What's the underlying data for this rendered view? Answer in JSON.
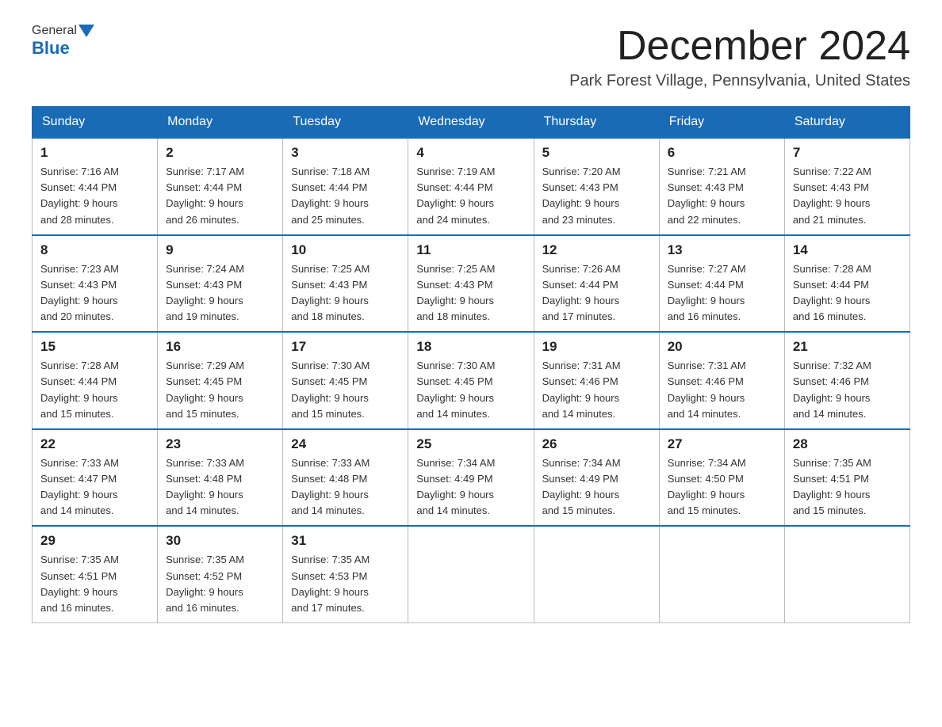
{
  "header": {
    "logo": {
      "general": "General",
      "blue": "Blue"
    },
    "title": "December 2024",
    "location": "Park Forest Village, Pennsylvania, United States"
  },
  "days_of_week": [
    "Sunday",
    "Monday",
    "Tuesday",
    "Wednesday",
    "Thursday",
    "Friday",
    "Saturday"
  ],
  "weeks": [
    [
      {
        "day": "1",
        "sunrise": "7:16 AM",
        "sunset": "4:44 PM",
        "daylight": "9 hours and 28 minutes."
      },
      {
        "day": "2",
        "sunrise": "7:17 AM",
        "sunset": "4:44 PM",
        "daylight": "9 hours and 26 minutes."
      },
      {
        "day": "3",
        "sunrise": "7:18 AM",
        "sunset": "4:44 PM",
        "daylight": "9 hours and 25 minutes."
      },
      {
        "day": "4",
        "sunrise": "7:19 AM",
        "sunset": "4:44 PM",
        "daylight": "9 hours and 24 minutes."
      },
      {
        "day": "5",
        "sunrise": "7:20 AM",
        "sunset": "4:43 PM",
        "daylight": "9 hours and 23 minutes."
      },
      {
        "day": "6",
        "sunrise": "7:21 AM",
        "sunset": "4:43 PM",
        "daylight": "9 hours and 22 minutes."
      },
      {
        "day": "7",
        "sunrise": "7:22 AM",
        "sunset": "4:43 PM",
        "daylight": "9 hours and 21 minutes."
      }
    ],
    [
      {
        "day": "8",
        "sunrise": "7:23 AM",
        "sunset": "4:43 PM",
        "daylight": "9 hours and 20 minutes."
      },
      {
        "day": "9",
        "sunrise": "7:24 AM",
        "sunset": "4:43 PM",
        "daylight": "9 hours and 19 minutes."
      },
      {
        "day": "10",
        "sunrise": "7:25 AM",
        "sunset": "4:43 PM",
        "daylight": "9 hours and 18 minutes."
      },
      {
        "day": "11",
        "sunrise": "7:25 AM",
        "sunset": "4:43 PM",
        "daylight": "9 hours and 18 minutes."
      },
      {
        "day": "12",
        "sunrise": "7:26 AM",
        "sunset": "4:44 PM",
        "daylight": "9 hours and 17 minutes."
      },
      {
        "day": "13",
        "sunrise": "7:27 AM",
        "sunset": "4:44 PM",
        "daylight": "9 hours and 16 minutes."
      },
      {
        "day": "14",
        "sunrise": "7:28 AM",
        "sunset": "4:44 PM",
        "daylight": "9 hours and 16 minutes."
      }
    ],
    [
      {
        "day": "15",
        "sunrise": "7:28 AM",
        "sunset": "4:44 PM",
        "daylight": "9 hours and 15 minutes."
      },
      {
        "day": "16",
        "sunrise": "7:29 AM",
        "sunset": "4:45 PM",
        "daylight": "9 hours and 15 minutes."
      },
      {
        "day": "17",
        "sunrise": "7:30 AM",
        "sunset": "4:45 PM",
        "daylight": "9 hours and 15 minutes."
      },
      {
        "day": "18",
        "sunrise": "7:30 AM",
        "sunset": "4:45 PM",
        "daylight": "9 hours and 14 minutes."
      },
      {
        "day": "19",
        "sunrise": "7:31 AM",
        "sunset": "4:46 PM",
        "daylight": "9 hours and 14 minutes."
      },
      {
        "day": "20",
        "sunrise": "7:31 AM",
        "sunset": "4:46 PM",
        "daylight": "9 hours and 14 minutes."
      },
      {
        "day": "21",
        "sunrise": "7:32 AM",
        "sunset": "4:46 PM",
        "daylight": "9 hours and 14 minutes."
      }
    ],
    [
      {
        "day": "22",
        "sunrise": "7:33 AM",
        "sunset": "4:47 PM",
        "daylight": "9 hours and 14 minutes."
      },
      {
        "day": "23",
        "sunrise": "7:33 AM",
        "sunset": "4:48 PM",
        "daylight": "9 hours and 14 minutes."
      },
      {
        "day": "24",
        "sunrise": "7:33 AM",
        "sunset": "4:48 PM",
        "daylight": "9 hours and 14 minutes."
      },
      {
        "day": "25",
        "sunrise": "7:34 AM",
        "sunset": "4:49 PM",
        "daylight": "9 hours and 14 minutes."
      },
      {
        "day": "26",
        "sunrise": "7:34 AM",
        "sunset": "4:49 PM",
        "daylight": "9 hours and 15 minutes."
      },
      {
        "day": "27",
        "sunrise": "7:34 AM",
        "sunset": "4:50 PM",
        "daylight": "9 hours and 15 minutes."
      },
      {
        "day": "28",
        "sunrise": "7:35 AM",
        "sunset": "4:51 PM",
        "daylight": "9 hours and 15 minutes."
      }
    ],
    [
      {
        "day": "29",
        "sunrise": "7:35 AM",
        "sunset": "4:51 PM",
        "daylight": "9 hours and 16 minutes."
      },
      {
        "day": "30",
        "sunrise": "7:35 AM",
        "sunset": "4:52 PM",
        "daylight": "9 hours and 16 minutes."
      },
      {
        "day": "31",
        "sunrise": "7:35 AM",
        "sunset": "4:53 PM",
        "daylight": "9 hours and 17 minutes."
      },
      null,
      null,
      null,
      null
    ]
  ],
  "labels": {
    "sunrise": "Sunrise:",
    "sunset": "Sunset:",
    "daylight": "Daylight:"
  }
}
